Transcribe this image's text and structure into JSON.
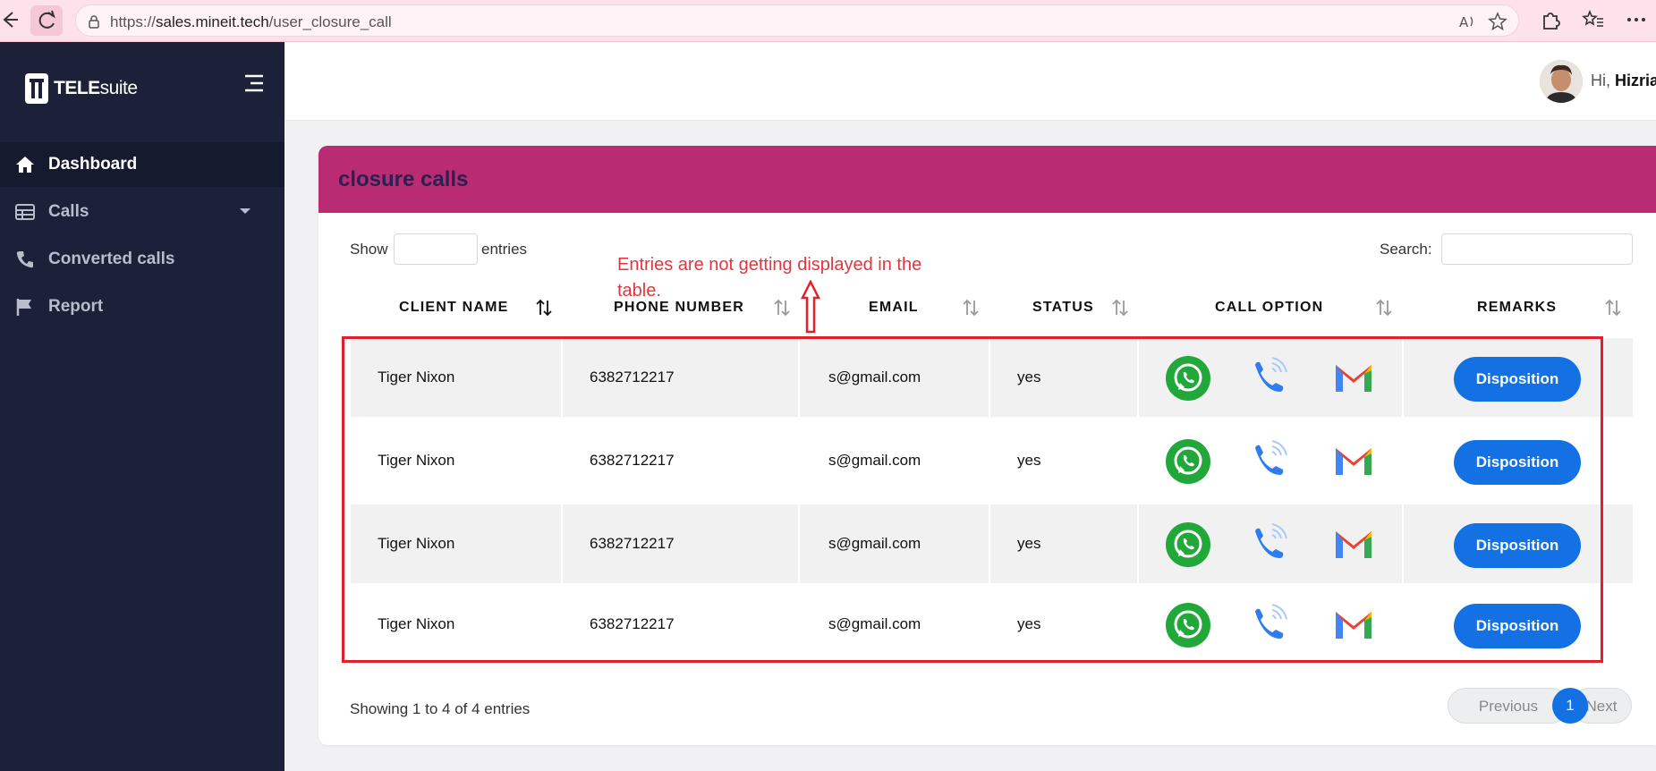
{
  "browser": {
    "url_prefix": "https://",
    "url_domain": "sales.mineit.tech",
    "url_path": "/user_closure_call"
  },
  "sidebar": {
    "logo_bold": "TELE",
    "logo_light": "suite",
    "items": [
      {
        "label": "Dashboard",
        "icon": "home-icon"
      },
      {
        "label": "Calls",
        "icon": "table-icon"
      },
      {
        "label": "Converted calls",
        "icon": "phone-icon"
      },
      {
        "label": "Report",
        "icon": "flag-icon"
      }
    ]
  },
  "header": {
    "greeting": "Hi,",
    "username": "Hizria"
  },
  "card": {
    "title": "closure calls"
  },
  "controls": {
    "show_label": "Show",
    "entries_label": "entries",
    "search_label": "Search:"
  },
  "annotation": {
    "text": "Entries are not getting displayed in the table."
  },
  "table": {
    "columns": [
      "CLIENT NAME",
      "PHONE NUMBER",
      "EMAIL",
      "STATUS",
      "CALL OPTION",
      "REMARKS"
    ],
    "rows": [
      {
        "client_name": "Tiger Nixon",
        "phone": "6382712217",
        "email": "s@gmail.com",
        "status": "yes",
        "remark_button": "Disposition"
      },
      {
        "client_name": "Tiger Nixon",
        "phone": "6382712217",
        "email": "s@gmail.com",
        "status": "yes",
        "remark_button": "Disposition"
      },
      {
        "client_name": "Tiger Nixon",
        "phone": "6382712217",
        "email": "s@gmail.com",
        "status": "yes",
        "remark_button": "Disposition"
      },
      {
        "client_name": "Tiger Nixon",
        "phone": "6382712217",
        "email": "s@gmail.com",
        "status": "yes",
        "remark_button": "Disposition"
      }
    ]
  },
  "footer": {
    "showing": "Showing 1 to 4 of 4 entries",
    "prev": "Previous",
    "page": "1",
    "next": "Next"
  },
  "colors": {
    "sidebar_bg": "#1c2139",
    "card_header": "#b92c74",
    "primary_button": "#1471e3",
    "annotation": "#e0373f"
  }
}
